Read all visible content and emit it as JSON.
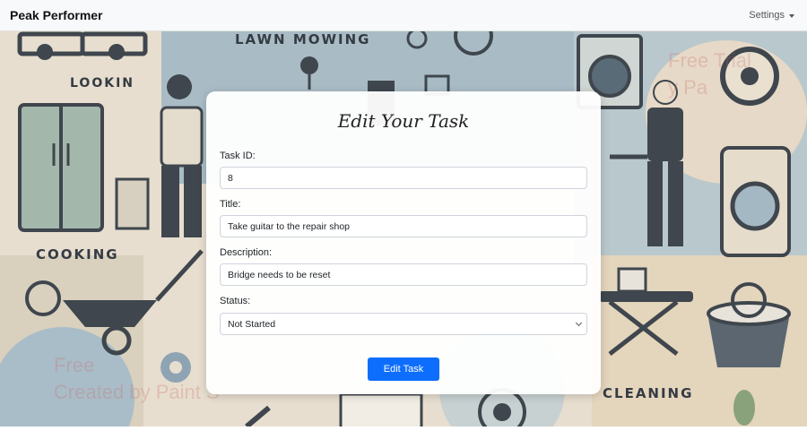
{
  "navbar": {
    "brand": "Peak Performer",
    "settings_label": "Settings"
  },
  "background": {
    "words": [
      "LAWN MOWING",
      "LOOKIN",
      "COOKING",
      "CLEANING"
    ],
    "watermark_lines": [
      "Free",
      "Created by Paint S"
    ],
    "watermark_top_right": [
      "Free Trial",
      "y Pa"
    ]
  },
  "form": {
    "title": "Edit Your Task",
    "fields": [
      {
        "label": "Task ID:",
        "value": "8"
      },
      {
        "label": "Title:",
        "value": "Take guitar to the repair shop"
      },
      {
        "label": "Description:",
        "value": "Bridge needs to be reset"
      }
    ],
    "status": {
      "label": "Status:",
      "value": "Not Started"
    },
    "submit_label": "Edit Task"
  },
  "colors": {
    "primary": "#0d6efd",
    "navbar_bg": "#f8f9fa"
  }
}
